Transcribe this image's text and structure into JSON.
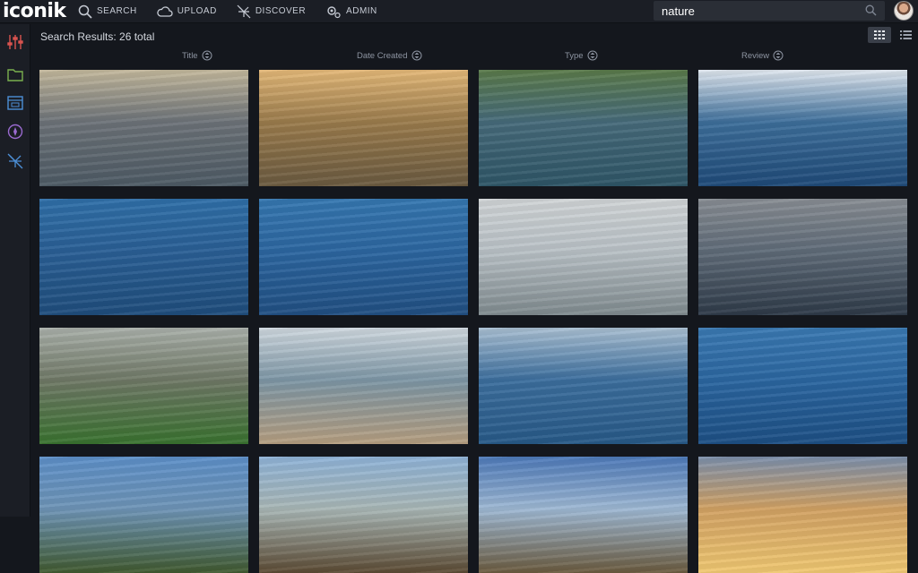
{
  "app": {
    "logo_text": "iconik"
  },
  "nav": [
    {
      "label": "SEARCH",
      "icon": "search-icon"
    },
    {
      "label": "UPLOAD",
      "icon": "cloud-icon"
    },
    {
      "label": "DISCOVER",
      "icon": "discover-icon"
    },
    {
      "label": "ADMIN",
      "icon": "admin-gear-icon"
    }
  ],
  "search": {
    "value": "nature"
  },
  "results": {
    "title": "Search Results: 26 total"
  },
  "columns": [
    "Title",
    "Date Created",
    "Type",
    "Review"
  ],
  "sidebar_icons": [
    "sliders-icon",
    "folder-icon",
    "calendar-icon",
    "compass-icon",
    "discover-off-icon"
  ],
  "thumbnails": [
    {
      "subject": "paddleboarder at sea with seagull",
      "colors": [
        "#c3b89c",
        "#6c7278",
        "#4d5a64"
      ]
    },
    {
      "subject": "surfer lying on board at sunset",
      "colors": [
        "#e3b878",
        "#9a7b4c",
        "#6a5a40"
      ]
    },
    {
      "subject": "paddleboarder in wetsuit near hills",
      "colors": [
        "#5a7a4a",
        "#466a7a",
        "#2e5566"
      ]
    },
    {
      "subject": "swimmer in breaking wave",
      "colors": [
        "#dfe6ee",
        "#3d6e9a",
        "#1f4a78"
      ]
    },
    {
      "subject": "boat and red flag on blue water",
      "colors": [
        "#2f6fa8",
        "#2a5f95",
        "#1f4d7c"
      ]
    },
    {
      "subject": "boat with people and red flag",
      "colors": [
        "#3577b0",
        "#2c66a0",
        "#214f82"
      ]
    },
    {
      "subject": "blurred foreground with swimmer",
      "colors": [
        "#d0d4d6",
        "#b9c1c6",
        "#7f8a8e"
      ]
    },
    {
      "subject": "athlete with board on water",
      "colors": [
        "#888d93",
        "#5f6b78",
        "#2e3a48"
      ]
    },
    {
      "subject": "athlete drinking from bottle on board",
      "colors": [
        "#aab0aa",
        "#6f7866",
        "#39722f"
      ]
    },
    {
      "subject": "man carrying blue board on beach",
      "colors": [
        "#cfd8df",
        "#7d96a5",
        "#b59e80"
      ]
    },
    {
      "subject": "paddler lying on board",
      "colors": [
        "#a9bfd2",
        "#3c6e9d",
        "#275987"
      ]
    },
    {
      "subject": "boat with crew and red flag",
      "colors": [
        "#3a79b2",
        "#2b66a0",
        "#1d4f84"
      ]
    },
    {
      "subject": "trees under blue sky",
      "colors": [
        "#5d8fc8",
        "#6e94b6",
        "#40592f"
      ]
    },
    {
      "subject": "tree branches against sky",
      "colors": [
        "#8fb3d7",
        "#a8b6b5",
        "#5b4a33"
      ]
    },
    {
      "subject": "oak tree and clouds",
      "colors": [
        "#4d79b8",
        "#9eb8d3",
        "#6a5a3e"
      ]
    },
    {
      "subject": "sunset clouds",
      "colors": [
        "#7c8fab",
        "#d1a163",
        "#f0c872"
      ]
    }
  ]
}
